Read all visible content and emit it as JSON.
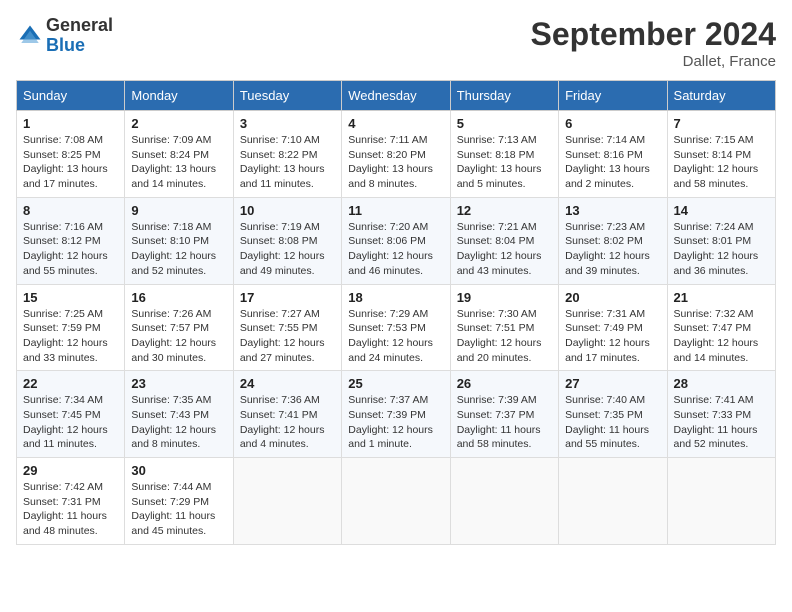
{
  "header": {
    "logo_general": "General",
    "logo_blue": "Blue",
    "month_title": "September 2024",
    "location": "Dallet, France"
  },
  "calendar": {
    "days_of_week": [
      "Sunday",
      "Monday",
      "Tuesday",
      "Wednesday",
      "Thursday",
      "Friday",
      "Saturday"
    ],
    "weeks": [
      [
        null,
        {
          "num": "2",
          "rise": "Sunrise: 7:09 AM",
          "set": "Sunset: 8:24 PM",
          "daylight": "Daylight: 13 hours and 14 minutes."
        },
        {
          "num": "3",
          "rise": "Sunrise: 7:10 AM",
          "set": "Sunset: 8:22 PM",
          "daylight": "Daylight: 13 hours and 11 minutes."
        },
        {
          "num": "4",
          "rise": "Sunrise: 7:11 AM",
          "set": "Sunset: 8:20 PM",
          "daylight": "Daylight: 13 hours and 8 minutes."
        },
        {
          "num": "5",
          "rise": "Sunrise: 7:13 AM",
          "set": "Sunset: 8:18 PM",
          "daylight": "Daylight: 13 hours and 5 minutes."
        },
        {
          "num": "6",
          "rise": "Sunrise: 7:14 AM",
          "set": "Sunset: 8:16 PM",
          "daylight": "Daylight: 13 hours and 2 minutes."
        },
        {
          "num": "7",
          "rise": "Sunrise: 7:15 AM",
          "set": "Sunset: 8:14 PM",
          "daylight": "Daylight: 12 hours and 58 minutes."
        }
      ],
      [
        {
          "num": "1",
          "rise": "Sunrise: 7:08 AM",
          "set": "Sunset: 8:25 PM",
          "daylight": "Daylight: 13 hours and 17 minutes."
        },
        null,
        null,
        null,
        null,
        null,
        null
      ],
      [
        {
          "num": "8",
          "rise": "Sunrise: 7:16 AM",
          "set": "Sunset: 8:12 PM",
          "daylight": "Daylight: 12 hours and 55 minutes."
        },
        {
          "num": "9",
          "rise": "Sunrise: 7:18 AM",
          "set": "Sunset: 8:10 PM",
          "daylight": "Daylight: 12 hours and 52 minutes."
        },
        {
          "num": "10",
          "rise": "Sunrise: 7:19 AM",
          "set": "Sunset: 8:08 PM",
          "daylight": "Daylight: 12 hours and 49 minutes."
        },
        {
          "num": "11",
          "rise": "Sunrise: 7:20 AM",
          "set": "Sunset: 8:06 PM",
          "daylight": "Daylight: 12 hours and 46 minutes."
        },
        {
          "num": "12",
          "rise": "Sunrise: 7:21 AM",
          "set": "Sunset: 8:04 PM",
          "daylight": "Daylight: 12 hours and 43 minutes."
        },
        {
          "num": "13",
          "rise": "Sunrise: 7:23 AM",
          "set": "Sunset: 8:02 PM",
          "daylight": "Daylight: 12 hours and 39 minutes."
        },
        {
          "num": "14",
          "rise": "Sunrise: 7:24 AM",
          "set": "Sunset: 8:01 PM",
          "daylight": "Daylight: 12 hours and 36 minutes."
        }
      ],
      [
        {
          "num": "15",
          "rise": "Sunrise: 7:25 AM",
          "set": "Sunset: 7:59 PM",
          "daylight": "Daylight: 12 hours and 33 minutes."
        },
        {
          "num": "16",
          "rise": "Sunrise: 7:26 AM",
          "set": "Sunset: 7:57 PM",
          "daylight": "Daylight: 12 hours and 30 minutes."
        },
        {
          "num": "17",
          "rise": "Sunrise: 7:27 AM",
          "set": "Sunset: 7:55 PM",
          "daylight": "Daylight: 12 hours and 27 minutes."
        },
        {
          "num": "18",
          "rise": "Sunrise: 7:29 AM",
          "set": "Sunset: 7:53 PM",
          "daylight": "Daylight: 12 hours and 24 minutes."
        },
        {
          "num": "19",
          "rise": "Sunrise: 7:30 AM",
          "set": "Sunset: 7:51 PM",
          "daylight": "Daylight: 12 hours and 20 minutes."
        },
        {
          "num": "20",
          "rise": "Sunrise: 7:31 AM",
          "set": "Sunset: 7:49 PM",
          "daylight": "Daylight: 12 hours and 17 minutes."
        },
        {
          "num": "21",
          "rise": "Sunrise: 7:32 AM",
          "set": "Sunset: 7:47 PM",
          "daylight": "Daylight: 12 hours and 14 minutes."
        }
      ],
      [
        {
          "num": "22",
          "rise": "Sunrise: 7:34 AM",
          "set": "Sunset: 7:45 PM",
          "daylight": "Daylight: 12 hours and 11 minutes."
        },
        {
          "num": "23",
          "rise": "Sunrise: 7:35 AM",
          "set": "Sunset: 7:43 PM",
          "daylight": "Daylight: 12 hours and 8 minutes."
        },
        {
          "num": "24",
          "rise": "Sunrise: 7:36 AM",
          "set": "Sunset: 7:41 PM",
          "daylight": "Daylight: 12 hours and 4 minutes."
        },
        {
          "num": "25",
          "rise": "Sunrise: 7:37 AM",
          "set": "Sunset: 7:39 PM",
          "daylight": "Daylight: 12 hours and 1 minute."
        },
        {
          "num": "26",
          "rise": "Sunrise: 7:39 AM",
          "set": "Sunset: 7:37 PM",
          "daylight": "Daylight: 11 hours and 58 minutes."
        },
        {
          "num": "27",
          "rise": "Sunrise: 7:40 AM",
          "set": "Sunset: 7:35 PM",
          "daylight": "Daylight: 11 hours and 55 minutes."
        },
        {
          "num": "28",
          "rise": "Sunrise: 7:41 AM",
          "set": "Sunset: 7:33 PM",
          "daylight": "Daylight: 11 hours and 52 minutes."
        }
      ],
      [
        {
          "num": "29",
          "rise": "Sunrise: 7:42 AM",
          "set": "Sunset: 7:31 PM",
          "daylight": "Daylight: 11 hours and 48 minutes."
        },
        {
          "num": "30",
          "rise": "Sunrise: 7:44 AM",
          "set": "Sunset: 7:29 PM",
          "daylight": "Daylight: 11 hours and 45 minutes."
        },
        null,
        null,
        null,
        null,
        null
      ]
    ]
  }
}
